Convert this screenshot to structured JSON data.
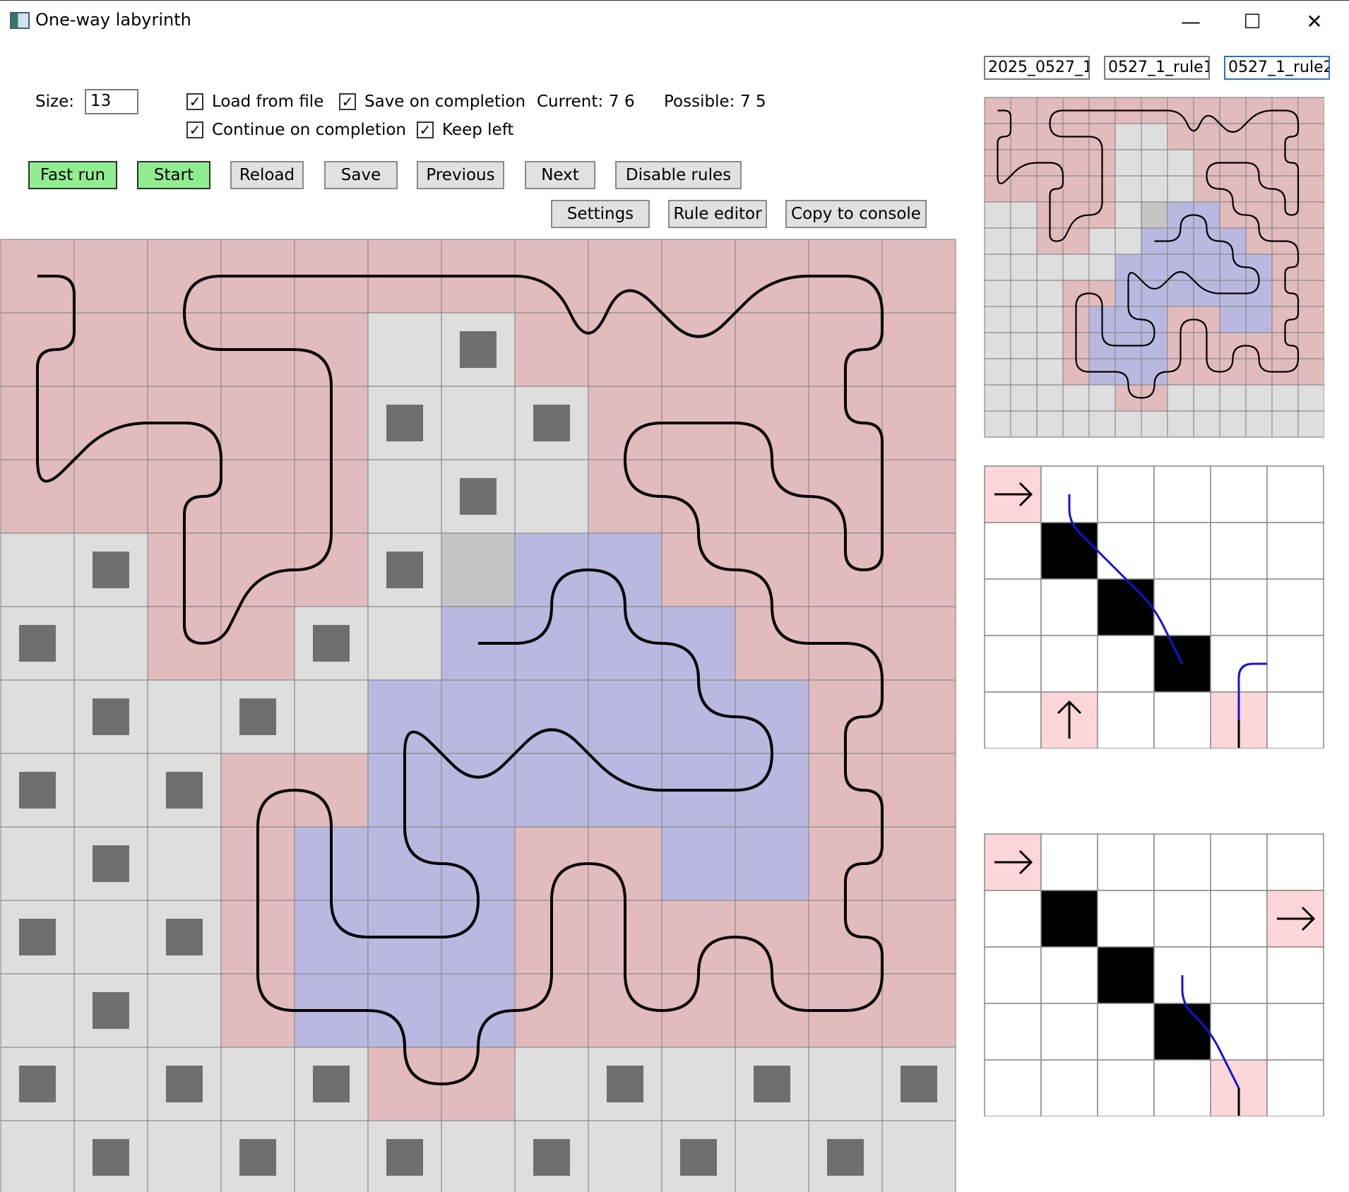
{
  "window": {
    "title": "One-way labyrinth",
    "minimize_glyph": "—",
    "maximize_glyph": "☐",
    "close_glyph": "✕"
  },
  "controls": {
    "size_label": "Size:",
    "size_value": "13",
    "load_from_file": "Load from file",
    "save_on_completion": "Save on completion",
    "continue_on_completion": "Continue on completion",
    "keep_left": "Keep left",
    "current_label": "Current:",
    "current_value": "7 6",
    "possible_label": "Possible:",
    "possible_value": "7 5",
    "check_glyph": "✓"
  },
  "buttons": {
    "fast_run": "Fast run",
    "start": "Start",
    "reload": "Reload",
    "save": "Save",
    "previous": "Previous",
    "next": "Next",
    "disable_rules": "Disable rules",
    "settings": "Settings",
    "rule_editor": "Rule editor",
    "copy_to_console": "Copy to console"
  },
  "files": [
    "2025_0527_1",
    "0527_1_rule1",
    "0527_1_rule2"
  ],
  "colors": {
    "pink": "#e2bbbd",
    "grey": "#dedede",
    "blue": "#b8b8e0",
    "dark": "#6f6f6f",
    "current": "#c4c4c4",
    "rule_pink": "#fcd6d8",
    "rule_line": "#1313d6",
    "button_green": "#90ee90"
  },
  "grid": {
    "size": 13,
    "rows": [
      "PPPPPPPPPPPPP",
      "PPPPPGXPPPPPP",
      "PPPPPXGXPPPPP",
      "PPPPPGXGPPPPP",
      "GXPPPXCBBPPPP",
      "XGPPXGBBBBPPP",
      "GXGXGBBBBBBPP",
      "XGXPPBBBBBBPP",
      "GXGPBBBPPBBPP",
      "XGXPBBBPPPPPP",
      "GXGPBBBPPPPPP",
      "XGXGXPPGXGXGX",
      "GXGXGXGXGXGXG"
    ],
    "path": [
      [
        0.5,
        0.5
      ],
      [
        1,
        0.5
      ],
      [
        1,
        1.5
      ],
      [
        0.5,
        1.5
      ],
      [
        0.5,
        3.5
      ],
      [
        1.5,
        2.5
      ],
      [
        3,
        2.5
      ],
      [
        3,
        3.5
      ],
      [
        2.5,
        3.5
      ],
      [
        2.5,
        5.5
      ],
      [
        3,
        5.5
      ],
      [
        3.5,
        4.5
      ],
      [
        4.5,
        4.5
      ],
      [
        4.5,
        1.5
      ],
      [
        2.5,
        1.5
      ],
      [
        2.5,
        0.5
      ],
      [
        7.5,
        0.5
      ],
      [
        8,
        1.5
      ],
      [
        8.5,
        0.5
      ],
      [
        9.5,
        1.5
      ],
      [
        10.5,
        0.5
      ],
      [
        12,
        0.5
      ],
      [
        12,
        1.5
      ],
      [
        11.5,
        1.5
      ],
      [
        11.5,
        2.5
      ],
      [
        12,
        2.5
      ],
      [
        12,
        4.5
      ],
      [
        11.5,
        4.5
      ],
      [
        11.5,
        3.5
      ],
      [
        10.5,
        3.5
      ],
      [
        10.5,
        2.5
      ],
      [
        8.5,
        2.5
      ],
      [
        8.5,
        3.5
      ],
      [
        9.5,
        3.5
      ],
      [
        9.5,
        4.5
      ],
      [
        10.5,
        4.5
      ],
      [
        10.5,
        5.5
      ],
      [
        12,
        5.5
      ],
      [
        12,
        6.5
      ],
      [
        11.5,
        6.5
      ],
      [
        11.5,
        7.5
      ],
      [
        12,
        7.5
      ],
      [
        12,
        8.5
      ],
      [
        11.5,
        8.5
      ],
      [
        11.5,
        9.5
      ],
      [
        12,
        9.5
      ],
      [
        12,
        10.5
      ],
      [
        10.5,
        10.5
      ],
      [
        10.5,
        9.5
      ],
      [
        9.5,
        9.5
      ],
      [
        9.5,
        10.5
      ],
      [
        8.5,
        10.5
      ],
      [
        8.5,
        8.5
      ],
      [
        7.5,
        8.5
      ],
      [
        7.5,
        10.5
      ],
      [
        6.5,
        10.5
      ],
      [
        6.5,
        11.5
      ],
      [
        5.5,
        11.5
      ],
      [
        5.5,
        10.5
      ],
      [
        3.5,
        10.5
      ],
      [
        3.5,
        7.5
      ],
      [
        4.5,
        7.5
      ],
      [
        4.5,
        9.5
      ],
      [
        6.5,
        9.5
      ],
      [
        6.5,
        8.5
      ],
      [
        5.5,
        8.5
      ],
      [
        5.5,
        6.5
      ],
      [
        6.5,
        7.5
      ],
      [
        7.5,
        6.5
      ],
      [
        8.5,
        7.5
      ],
      [
        10.5,
        7.5
      ],
      [
        10.5,
        6.5
      ],
      [
        9.5,
        6.5
      ],
      [
        9.5,
        5.5
      ],
      [
        8.5,
        5.5
      ],
      [
        8.5,
        4.5
      ],
      [
        7.5,
        4.5
      ],
      [
        7.5,
        5.5
      ],
      [
        6.5,
        5.5
      ]
    ]
  },
  "rules": [
    {
      "cols": 6,
      "rows": 5,
      "pink_cells": [
        [
          0,
          0
        ],
        [
          1,
          4
        ],
        [
          4,
          4
        ]
      ],
      "black_cells": [
        [
          1,
          1
        ],
        [
          2,
          2
        ],
        [
          3,
          3
        ]
      ],
      "arrows": [
        {
          "cell": [
            0,
            0
          ],
          "dir": "right"
        },
        {
          "cell": [
            1,
            4
          ],
          "dir": "up"
        }
      ],
      "blue_paths": [
        [
          [
            1.5,
            0.5
          ],
          [
            1.5,
            1
          ],
          [
            2,
            1.5
          ],
          [
            2.5,
            2
          ],
          [
            3,
            2.5
          ],
          [
            3.5,
            3.5
          ]
        ],
        [
          [
            4.5,
            4.5
          ],
          [
            4.5,
            3.5
          ],
          [
            5,
            3.5
          ]
        ]
      ],
      "black_stub": [
        [
          4.5,
          4.5
        ],
        [
          4.5,
          5
        ]
      ]
    },
    {
      "cols": 6,
      "rows": 5,
      "pink_cells": [
        [
          0,
          0
        ],
        [
          5,
          1
        ],
        [
          4,
          4
        ]
      ],
      "black_cells": [
        [
          1,
          1
        ],
        [
          2,
          2
        ],
        [
          3,
          3
        ]
      ],
      "arrows": [
        {
          "cell": [
            0,
            0
          ],
          "dir": "right"
        },
        {
          "cell": [
            5,
            1
          ],
          "dir": "right"
        }
      ],
      "blue_paths": [
        [
          [
            3.5,
            2.5
          ],
          [
            3.5,
            3
          ],
          [
            4,
            3.5
          ],
          [
            4.5,
            4.5
          ]
        ]
      ],
      "black_stub": [
        [
          4.5,
          4.5
        ],
        [
          4.5,
          5
        ]
      ]
    }
  ]
}
